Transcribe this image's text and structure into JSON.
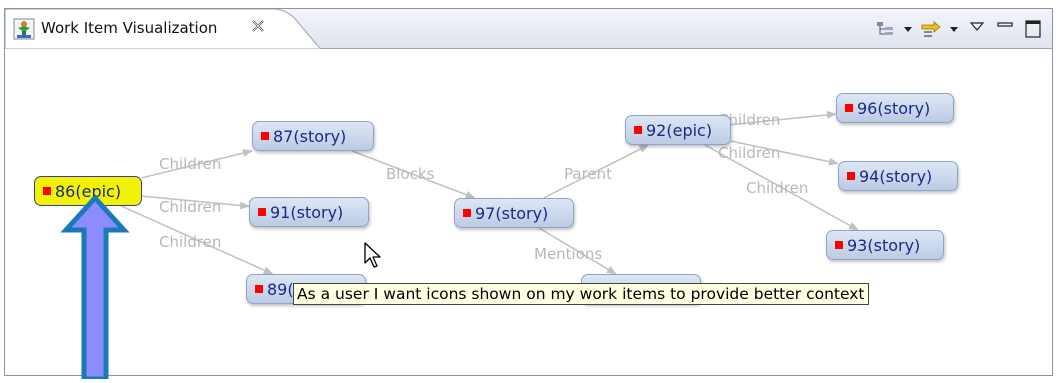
{
  "tab": {
    "title": "Work Item Visualization",
    "close_icon": "close-tab-icon",
    "app_icon": "visualization-view-icon"
  },
  "toolbar": {
    "items": [
      "layout-tree-icon",
      "dropdown-arrow-icon",
      "filter-arrows-icon",
      "dropdown-arrow-icon",
      "view-menu-icon",
      "minimize-icon",
      "maximize-icon"
    ]
  },
  "nodes": [
    {
      "id": "86",
      "label": "86(epic)",
      "selected": true
    },
    {
      "id": "87",
      "label": "87(story)"
    },
    {
      "id": "91",
      "label": "91(story)"
    },
    {
      "id": "89",
      "label": "89(story)"
    },
    {
      "id": "97",
      "label": "97(story)"
    },
    {
      "id": "92",
      "label": "92(epic)"
    },
    {
      "id": "96",
      "label": "96(story)"
    },
    {
      "id": "94",
      "label": "94(story)"
    },
    {
      "id": "93",
      "label": "93(story)"
    },
    {
      "id": "90",
      "label": "90(story)"
    }
  ],
  "edges": [
    {
      "from": "86",
      "to": "87",
      "label": "Children"
    },
    {
      "from": "86",
      "to": "91",
      "label": "Children"
    },
    {
      "from": "86",
      "to": "89",
      "label": "Children"
    },
    {
      "from": "87",
      "to": "97",
      "label": "Blocks"
    },
    {
      "from": "97",
      "to": "92",
      "label": "Parent"
    },
    {
      "from": "97",
      "to": "90",
      "label": "Mentions"
    },
    {
      "from": "92",
      "to": "96",
      "label": "Children"
    },
    {
      "from": "92",
      "to": "94",
      "label": "Children"
    },
    {
      "from": "92",
      "to": "93",
      "label": "Children"
    }
  ],
  "tooltip": "As a user I want  icons shown on my work items to provide better context",
  "colors": {
    "node_fill": "#c8d4ea",
    "selected_fill": "#f3f300",
    "node_text": "#1a2a8a",
    "edge": "#c0c0c0",
    "edge_label": "#b8b8b8",
    "marker": "#ff0000",
    "annotation_arrow": "#8c8cff"
  }
}
